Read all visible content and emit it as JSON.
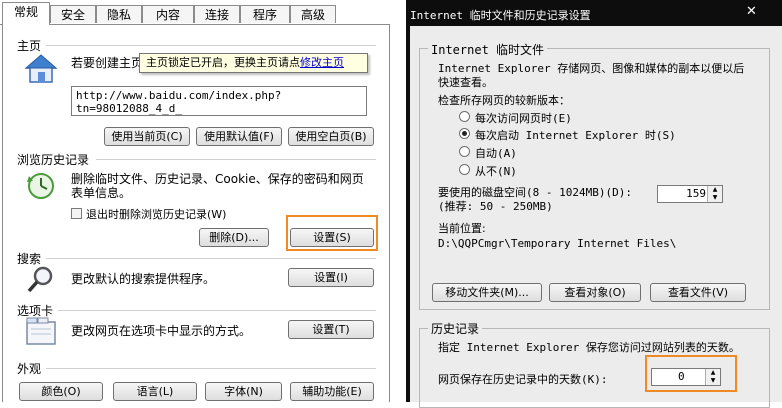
{
  "tabs": [
    "常规",
    "安全",
    "隐私",
    "内容",
    "连接",
    "程序",
    "高级"
  ],
  "home": {
    "section": "主页",
    "desc_prefix": "若要创建主页",
    "tooltip_text": "主页锁定已开启，更换主页请点",
    "tooltip_link": "修改主页",
    "url": "http://www.baidu.com/index.php?tn=98012088_4_d",
    "url_cursor": "_",
    "buttons": [
      "使用当前页(C)",
      "使用默认值(F)",
      "使用空白页(B)"
    ]
  },
  "history": {
    "section": "浏览历史记录",
    "desc1": "删除临时文件、历史记录、Cookie、保存的密码和网页",
    "desc2": "表单信息。",
    "checkbox": "退出时删除浏览历史记录(W)",
    "buttons": [
      "删除(D)...",
      "设置(S)"
    ]
  },
  "search": {
    "section": "搜索",
    "desc": "更改默认的搜索提供程序。",
    "button": "设置(I)"
  },
  "tabsec": {
    "section": "选项卡",
    "desc": "更改网页在选项卡中显示的方式。",
    "button": "设置(T)"
  },
  "appearance": {
    "section": "外观",
    "buttons": [
      "颜色(O)",
      "语言(L)",
      "字体(N)",
      "辅助功能(E)"
    ]
  },
  "dialog": {
    "title": "Internet 临时文件和历史记录设置",
    "close": "✕",
    "temp": {
      "group": "Internet 临时文件",
      "desc1": "Internet Explorer 存储网页、图像和媒体的副本以便以后",
      "desc2": "快速查看。",
      "check_label": "检查所存网页的较新版本：",
      "options": [
        "每次访问网页时(E)",
        "每次启动 Internet Explorer 时(S)",
        "自动(A)",
        "从不(N)"
      ],
      "selected": 1,
      "disk_label": "要使用的磁盘空间(8 - 1024MB)(D):",
      "disk_hint": "(推荐: 50 - 250MB)",
      "disk_value": "159",
      "loc_label": "当前位置:",
      "loc_path": "D:\\QQPCmgr\\Temporary Internet Files\\",
      "buttons": [
        "移动文件夹(M)...",
        "查看对象(O)",
        "查看文件(V)"
      ]
    },
    "hist": {
      "group": "历史记录",
      "desc": "指定 Internet Explorer 保存您访问过网站列表的天数。",
      "days_label": "网页保存在历史记录中的天数(K):",
      "days_value": "0"
    }
  },
  "colors": {
    "highlight": "#f08a24",
    "tooltip_bg": "#ffffe1",
    "link": "#0000cc"
  },
  "icons": [
    "house-icon",
    "history-clock-icon",
    "magnifier-icon",
    "tabs-window-icon"
  ]
}
